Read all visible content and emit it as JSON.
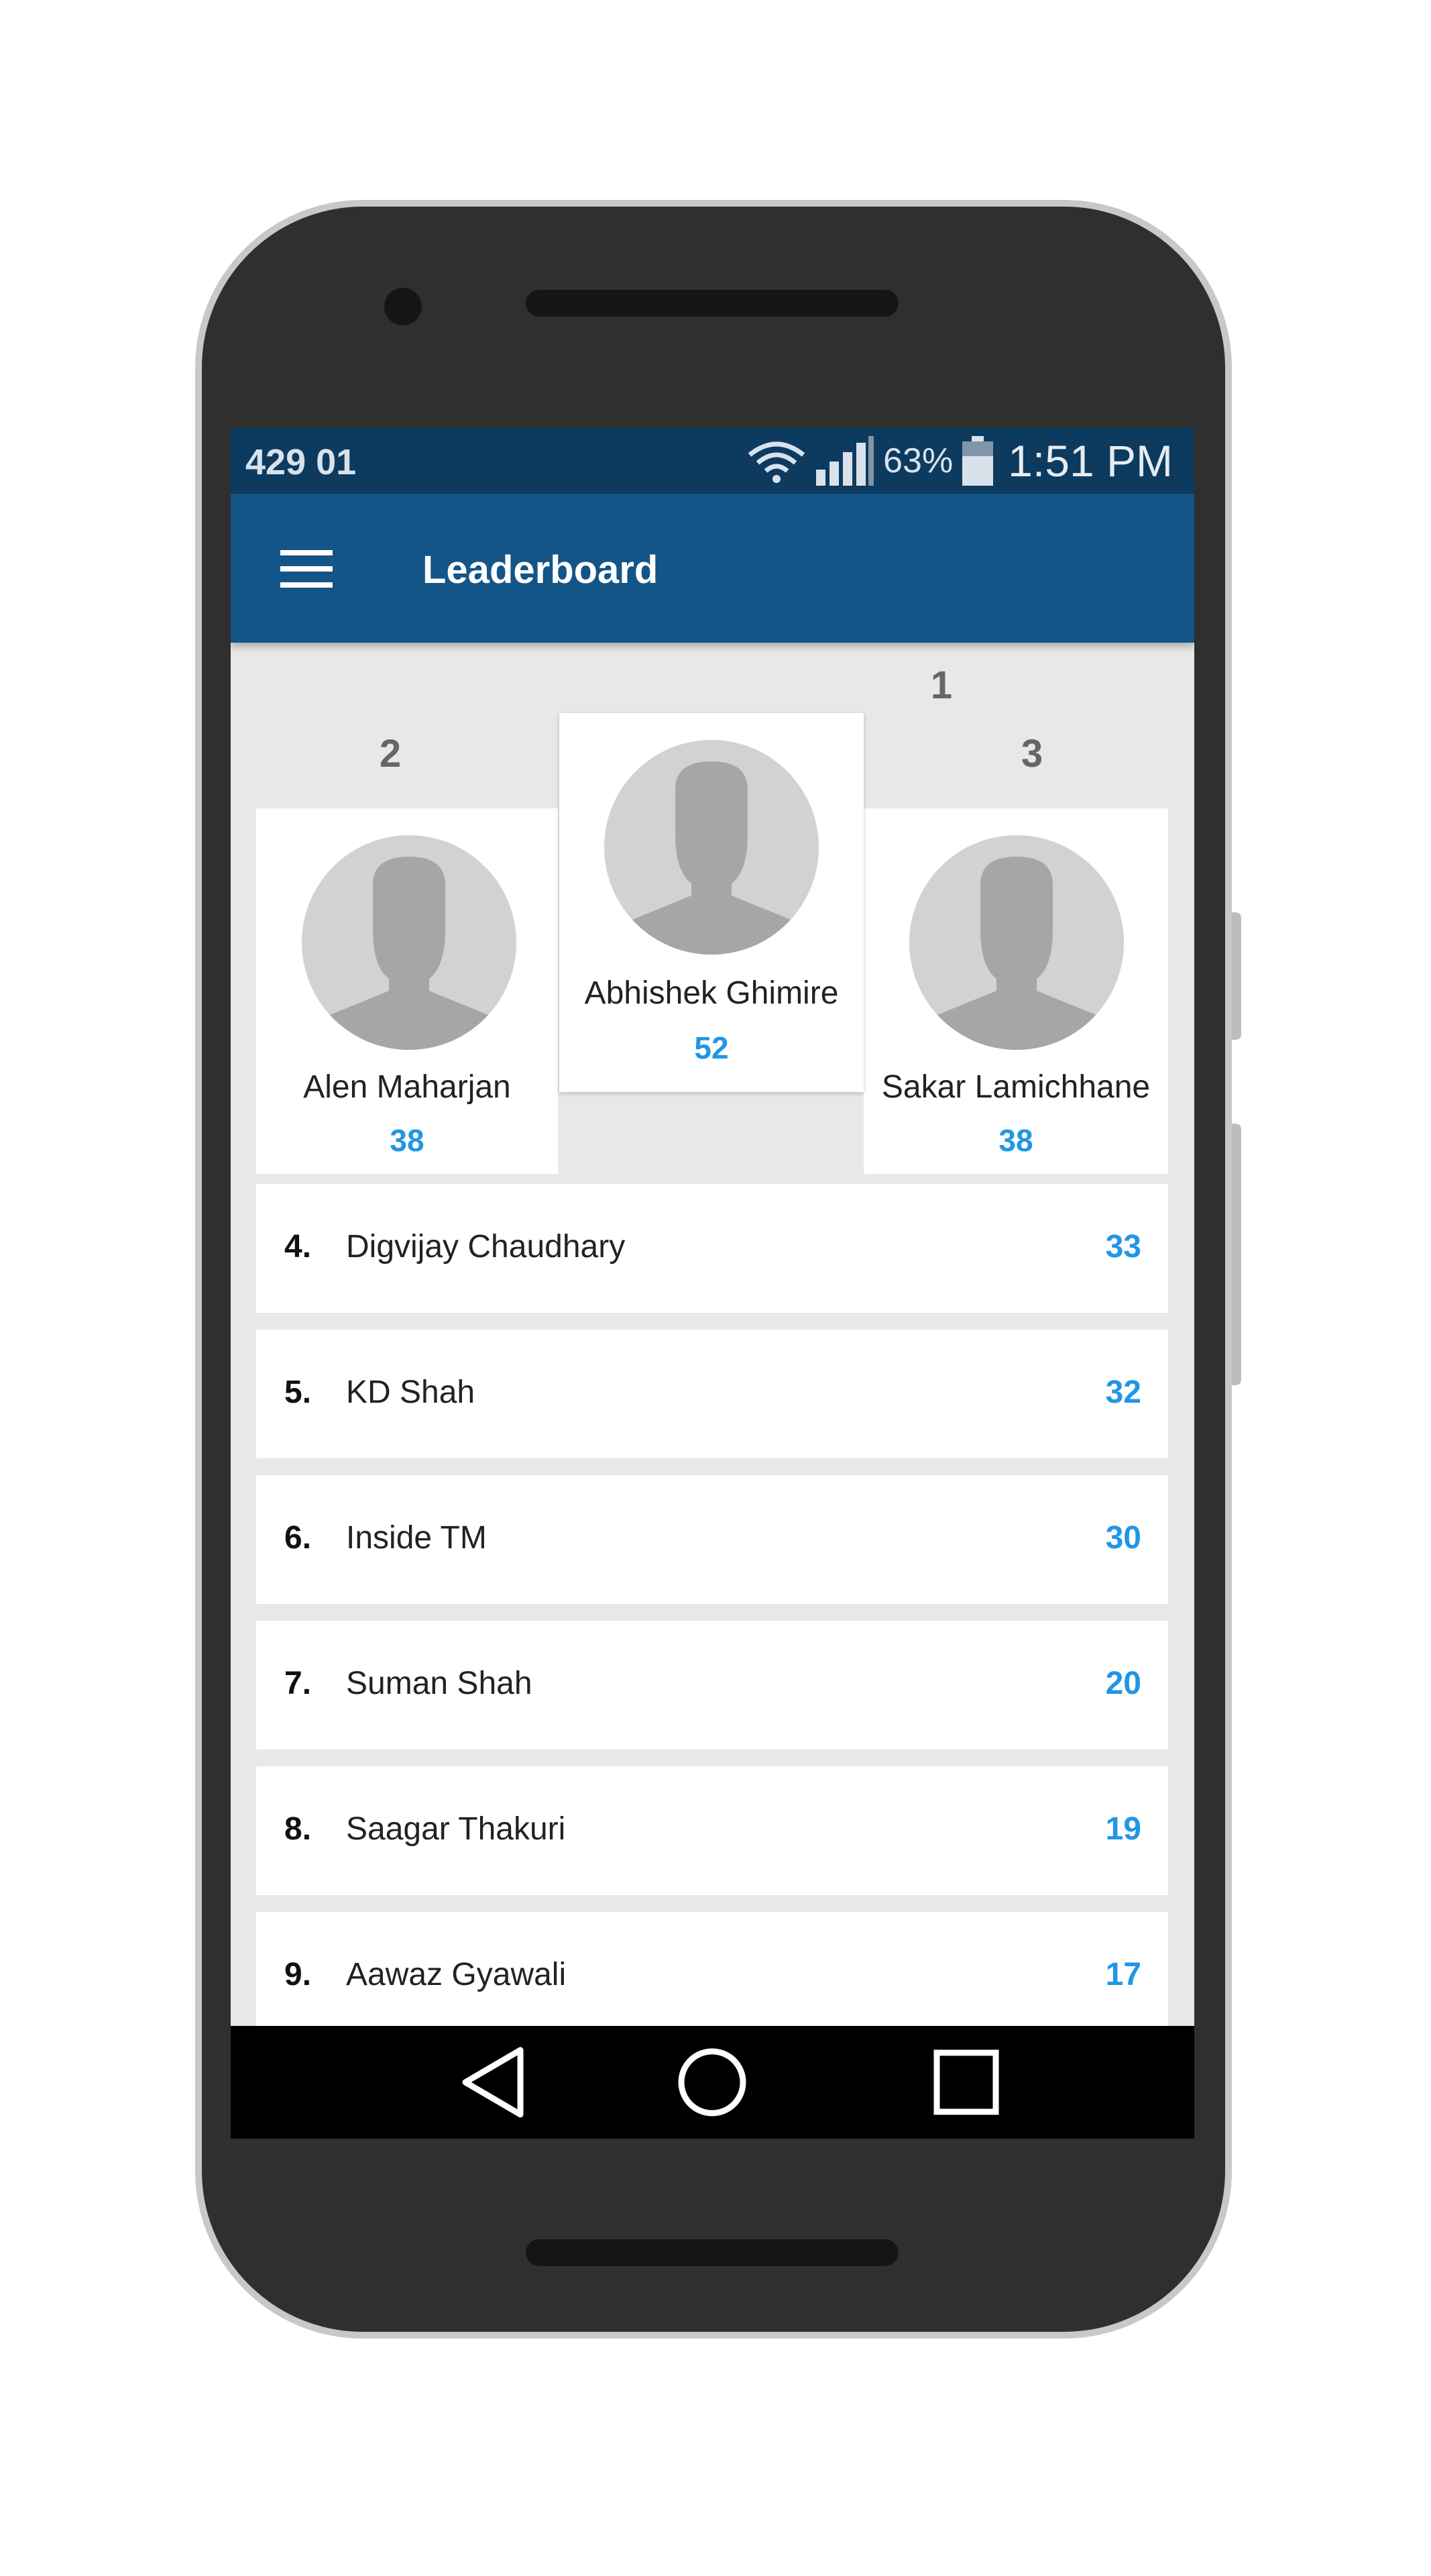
{
  "status_bar": {
    "carrier": "429 01",
    "battery": "63%",
    "time": "1:51 PM",
    "icons": [
      "wifi-icon",
      "signal-icon",
      "battery-icon"
    ]
  },
  "app_bar": {
    "title": "Leaderboard",
    "menu_icon": "hamburger-menu-icon"
  },
  "podium": {
    "first": {
      "rank": "1",
      "name": "Abhishek Ghimire",
      "score": "52"
    },
    "second": {
      "rank": "2",
      "name": "Alen Maharjan",
      "score": "38"
    },
    "third": {
      "rank": "3",
      "name": "Sakar Lamichhane",
      "score": "38"
    }
  },
  "list": [
    {
      "rank": "4.",
      "name": "Digvijay Chaudhary",
      "score": "33"
    },
    {
      "rank": "5.",
      "name": "KD Shah",
      "score": "32"
    },
    {
      "rank": "6.",
      "name": "Inside TM",
      "score": "30"
    },
    {
      "rank": "7.",
      "name": "Suman Shah",
      "score": "20"
    },
    {
      "rank": "8.",
      "name": "Saagar Thakuri",
      "score": "19"
    },
    {
      "rank": "9.",
      "name": "Aawaz Gyawali",
      "score": "17"
    }
  ],
  "nav_bar": {
    "icons": [
      "back-icon",
      "home-icon",
      "recents-icon"
    ]
  },
  "colors": {
    "status_bar": "#0d3a5f",
    "app_bar": "#135587",
    "score": "#2196e6",
    "background": "#e8e8e8"
  }
}
